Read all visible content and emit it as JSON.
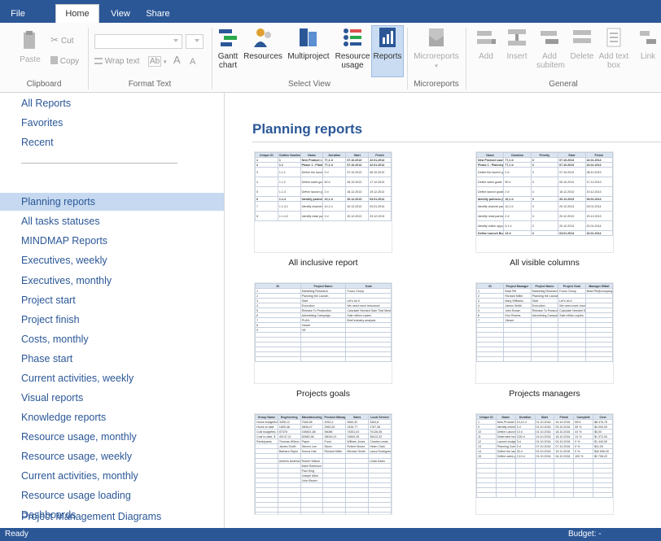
{
  "tabs": {
    "file": "File",
    "home": "Home",
    "view": "View",
    "share": "Share"
  },
  "ribbon": {
    "clipboard": {
      "paste": "Paste",
      "cut": "Cut",
      "copy": "Copy",
      "label": "Clipboard"
    },
    "format_text": {
      "wrap_text": "Wrap text",
      "ab": "Ab",
      "grow": "A",
      "shrink": "A",
      "label": "Format Text"
    },
    "select_view": {
      "gantt_line1": "Gantt",
      "gantt_line2": "chart",
      "resources": "Resources",
      "multiproject": "Multiproject",
      "resource_usage_line1": "Resource",
      "resource_usage_line2": "usage",
      "reports": "Reports",
      "label": "Select View"
    },
    "microreports": {
      "microreports": "Microreports",
      "label": "Microreports"
    },
    "general": {
      "add": "Add",
      "insert": "Insert",
      "add_subitem_line1": "Add",
      "add_subitem_line2": "subitem",
      "delete": "Delete",
      "add_textbox_line1": "Add text",
      "add_textbox_line2": "box",
      "link": "Link",
      "label": "General"
    },
    "colors": {
      "accent": "#2b5797",
      "selected": "#c6d9f0"
    }
  },
  "nav": {
    "items": [
      "All Reports",
      "Favorites",
      "Recent",
      "Planning reports",
      "All tasks statuses",
      "MINDMAP Reports",
      "Executives, weekly",
      "Executives, monthly",
      "Project start",
      "Project finish",
      "Costs, monthly",
      "Phase start",
      "Current activities, weekly",
      "Visual reports",
      "Knowledge reports",
      "Resource usage, monthly",
      "Resource usage, weekly",
      "Current activities, monthly",
      "Resource usage loading",
      "Dashboards",
      "Project Management Diagrams"
    ],
    "selected": "Planning reports"
  },
  "content": {
    "title": "Planning reports",
    "thumbs": [
      {
        "caption": "All inclusive report",
        "headers": [
          "Unique ID",
          "Outline Number",
          "Name",
          "Duration",
          "Start",
          "Finish"
        ],
        "rows": [
          [
            "1",
            "1",
            "New Product Launch",
            "77,1 d",
            "07.10.2013",
            "22.01.2014"
          ],
          [
            "2",
            "1.1",
            "Phase 1 - Planning the Launch",
            "77,1 d",
            "07.10.2013",
            "22.01.2014"
          ],
          [
            "3",
            "1.1.1",
            "Define the launch group",
            "2 d",
            "07.10.2013",
            "08.10.2013"
          ],
          [
            "4",
            "1.1.2",
            "Define sales goals",
            "50 d",
            "09.10.2013",
            "17.12.2013"
          ],
          [
            "5",
            "1.1.3",
            "Define launch goals (launch timing and publicity objectives)",
            "2 d",
            "18.12.2013",
            "19.12.2013"
          ],
          [
            "6",
            "1.1.4",
            "Identify partners (if needed)",
            "10,1 d",
            "20.12.2013",
            "03.01.2014"
          ],
          [
            "7",
            "1.1.4.1",
            "Identify channel partners",
            "10,1 d",
            "20.12.2013",
            "03.01.2014"
          ],
          [
            "8",
            "1.1.4.2",
            "Identify retail partners",
            "2 d",
            "20.12.2013",
            "23.12.2013"
          ]
        ]
      },
      {
        "caption": "All visible columns",
        "headers": [
          "Name",
          "Duration",
          "Priority",
          "Start",
          "Finish"
        ],
        "rows": [
          [
            "New Product Launch",
            "77,1 d",
            "3",
            "07.10.2013",
            "22.01.2014"
          ],
          [
            "Phase 1 - Planning the Launch",
            "77,1 d",
            "3",
            "07.10.2013",
            "22.01.2014"
          ],
          [
            "Define the launch group",
            "2 d",
            "3",
            "07.10.2013",
            "08.10.2013"
          ],
          [
            "Define sales goals",
            "50 d",
            "3",
            "09.10.2013",
            "17.12.2013"
          ],
          [
            "Define launch goals (launch timing and publicity objectives)",
            "2 d",
            "4",
            "18.12.2013",
            "19.12.2013"
          ],
          [
            "Identify partners (if needed)",
            "10,1 d",
            "3",
            "20.12.2013",
            "03.01.2014"
          ],
          [
            "Identify channel partners",
            "10,1 d",
            "3",
            "20.12.2013",
            "03.01.2014"
          ],
          [
            "Identify retail partners",
            "2 d",
            "3",
            "20.12.2013",
            "23.12.2013"
          ],
          [
            "Identify online opportunities",
            "9,1 d",
            "3",
            "20.12.2013",
            "02.01.2014"
          ],
          [
            "Define Launch Budget",
            "13 d",
            "3",
            "03.01.2014",
            "22.01.2014"
          ]
        ]
      },
      {
        "caption": "Projects goals",
        "headers": [
          "ID",
          "Project Name",
          "Goal"
        ],
        "rows": [
          [
            "1",
            "Marketing Research",
            "Focus Group"
          ],
          [
            "2",
            "Planning the Launch",
            ""
          ],
          [
            "3",
            "Start",
            "Let's do it"
          ],
          [
            "4",
            "Execution",
            "We need more resources"
          ],
          [
            "5",
            "Release To Production",
            "Calculate Needed Sale That Must Be Generated From Each Salesperson"
          ],
          [
            "6",
            "Advertising Campaign",
            "Sale million copies"
          ],
          [
            "7",
            "PLAN",
            "Brief industry analysis"
          ],
          [
            "8",
            "Viewer",
            ""
          ],
          [
            "9",
            "VR",
            ""
          ]
        ]
      },
      {
        "caption": "Projects managers",
        "headers": [
          "ID",
          "Project Manager",
          "Project Name",
          "Project Goal",
          "Manager EMail"
        ],
        "rows": [
          [
            "1",
            "Brad Pitt",
            "Marketing Research",
            "Focus Group",
            "Brad.Pitt@company.com"
          ],
          [
            "2",
            "Richard Miller",
            "Planning the Launch",
            "",
            ""
          ],
          [
            "3",
            "Mary Williams",
            "Start",
            "Let's do it",
            ""
          ],
          [
            "4",
            "James Smith",
            "Execution",
            "We need more resources",
            ""
          ],
          [
            "5",
            "John Brown",
            "Release To Production",
            "Calculate Needed Sale That Must Be Generated From Each",
            ""
          ],
          [
            "6",
            "Dior Reams",
            "Advertising Campaign",
            "Sale million copies",
            ""
          ],
          [
            "7",
            "Viewer",
            "",
            "",
            ""
          ]
        ]
      },
      {
        "caption": "",
        "headers": [
          "Group Name",
          "Engineering",
          "Manufacturing",
          "Product Manager",
          "Sales",
          "Local Service"
        ],
        "rows": [
          [
            "Hours budgeted",
            "3495,12",
            "7646,56",
            "4932,4",
            "3084,32",
            "3464,8"
          ],
          [
            "Hours to date",
            "1805,48",
            "3808,47",
            "2562,62",
            "1326,77",
            "1767,38"
          ],
          [
            "Cost budgeted, $",
            "87378",
            "165601,68",
            "56086",
            "74351,04",
            "70126,08"
          ],
          [
            "Cost to date, $",
            "40137,11",
            "82682,56",
            "28049,21",
            "31840,26",
            "35413,32"
          ],
          [
            "Participants",
            "Thomas Wilson",
            "Paper",
            "Fund",
            "William Jones",
            "Charles Lewis"
          ],
          [
            "",
            "James Smith",
            "Steven Lee",
            "Nixon",
            "Robert Moore",
            "Helen Clark"
          ],
          [
            "",
            "Barbara Taylor",
            "Donna Hall",
            "Richard Miller",
            "Michael Smith",
            "Laura Rodriguez"
          ],
          [
            "",
            "",
            "",
            "",
            "",
            ""
          ],
          [
            "",
            "Andrew Anderson",
            "Robert Wilson",
            "",
            "",
            "Linda Davis"
          ],
          [
            "",
            "",
            "Mark Robinson",
            "",
            "",
            ""
          ],
          [
            "",
            "",
            "Paul King",
            "",
            "",
            ""
          ],
          [
            "",
            "",
            "Joseph Allen",
            "",
            "",
            ""
          ],
          [
            "",
            "",
            "John Brown",
            "",
            "",
            ""
          ]
        ]
      },
      {
        "caption": "",
        "headers": [
          "Unique ID",
          "Name",
          "Duration",
          "Start",
          "Finish",
          "Complete",
          "Cost"
        ],
        "rows": [
          [
            "1",
            "New Product Launch",
            "10,14 d",
            "01.10.2016",
            "15.10.2016",
            "55%",
            "$8 476,76"
          ],
          [
            "9",
            "Identify online opportunities",
            "3 d",
            "01.10.2016",
            "03.10.2016",
            "55 %",
            "$4 000,00"
          ],
          [
            "10",
            "Define Launch Budget",
            "13 d",
            "01.10.2016",
            "18.10.2016",
            "44 %",
            "$0,00"
          ],
          [
            "11",
            "Determine budget requirements",
            "3,50 d",
            "15.10.2016",
            "18.10.2016",
            "14 %",
            "$1 372,00"
          ],
          [
            "12",
            "Launch budget approval",
            "3 d",
            "01.10.2016",
            "04.10.2016",
            "0 %",
            "$1 440,00"
          ],
          [
            "13",
            "Planning Complete",
            "0 d",
            "07.10.2016",
            "07.10.2016",
            "0 %",
            "$31,00"
          ],
          [
            "14",
            "Define the launch group",
            "33 d",
            "02.10.2016",
            "15.11.2016",
            "0 %",
            "$40 696,00"
          ],
          [
            "15",
            "Define sales goals",
            "2,13 d",
            "01.10.2016",
            "04.10.2016",
            "100 %",
            "$2 708,22"
          ]
        ]
      }
    ]
  },
  "status": {
    "ready": "Ready",
    "budget": "Budget: -"
  }
}
